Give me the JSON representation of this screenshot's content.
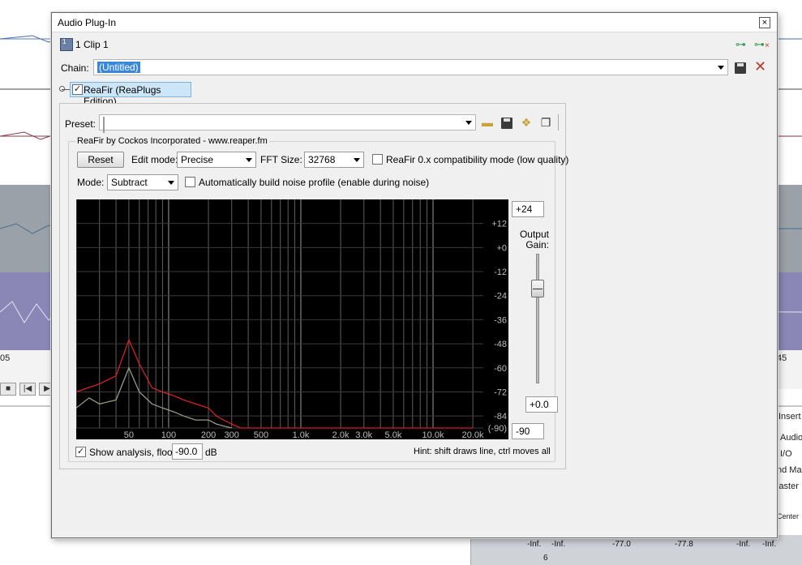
{
  "dialog": {
    "title": "Audio Plug-In",
    "clip_badge": "1",
    "clip_label": "1 Clip 1",
    "chain_label": "Chain:",
    "chain_value": "(Untitled)",
    "fx_item": "ReaFir (ReaPlugs Edition)"
  },
  "plugin": {
    "preset_label": "Preset:",
    "preset_value": "",
    "group_title": "ReaFir by Cockos Incorporated - www.reaper.fm",
    "reset_label": "Reset",
    "edit_mode_label": "Edit mode:",
    "edit_mode_value": "Precise",
    "fft_label": "FFT Size:",
    "fft_value": "32768",
    "compat_label": "ReaFir 0.x compatibility mode (low quality)",
    "mode_label": "Mode:",
    "mode_value": "Subtract",
    "auto_label": "Automatically build noise profile (enable during noise)",
    "show_analysis_label": "Show analysis, floor:",
    "floor_value": "-90.0",
    "floor_unit": "dB",
    "hint": "Hint: shift draws line, ctrl moves all"
  },
  "gain": {
    "top_value": "+24",
    "label_line1": "Output",
    "label_line2": "Gain:",
    "gain_value": "+0.0",
    "bottom_value": "-90",
    "level_db": 0.0
  },
  "chart_data": {
    "type": "line",
    "x_scale": "log",
    "x_ticks": [
      "50",
      "100",
      "200",
      "300",
      "500",
      "1.0k",
      "2.0k",
      "3.0k",
      "5.0k",
      "10.0k",
      "20.0k"
    ],
    "y_ticks": [
      "+12",
      "+0",
      "-12",
      "-24",
      "-36",
      "-48",
      "-60",
      "-72",
      "-84",
      "(-90)"
    ],
    "ylim": [
      -90,
      24
    ],
    "series": [
      {
        "color": "#d42020",
        "x": [
          20,
          30,
          40,
          50,
          60,
          75,
          90,
          110,
          130,
          160,
          200,
          230,
          260,
          300,
          350,
          500,
          1000,
          2000,
          5000,
          10000,
          20000
        ],
        "y": [
          -72,
          -68,
          -64,
          -46,
          -58,
          -70,
          -72,
          -74,
          -76,
          -78,
          -80,
          -84,
          -86,
          -88,
          -90,
          -90,
          -90,
          -90,
          -90,
          -90,
          -90
        ]
      },
      {
        "color": "#9a9a80",
        "x": [
          20,
          25,
          30,
          40,
          50,
          60,
          75,
          90,
          110,
          130,
          160,
          200,
          230,
          260,
          300
        ],
        "y": [
          -80,
          -75,
          -78,
          -76,
          -60,
          -72,
          -78,
          -80,
          -82,
          -84,
          -86,
          -86,
          -88,
          -89,
          -90
        ]
      }
    ]
  },
  "background": {
    "marker_left": "05",
    "marker_right": "45",
    "insert_label": "Insert",
    "audio_label": "Audio",
    "io_label": "I/O",
    "ndma_label": "nd Ma",
    "master_label": "laster",
    "center_label": "Center",
    "mixer_values": [
      "-Inf.",
      "-Inf.",
      "-77.0",
      "-77.8",
      "-Inf.",
      "-Inf."
    ],
    "channel_number": "6"
  }
}
